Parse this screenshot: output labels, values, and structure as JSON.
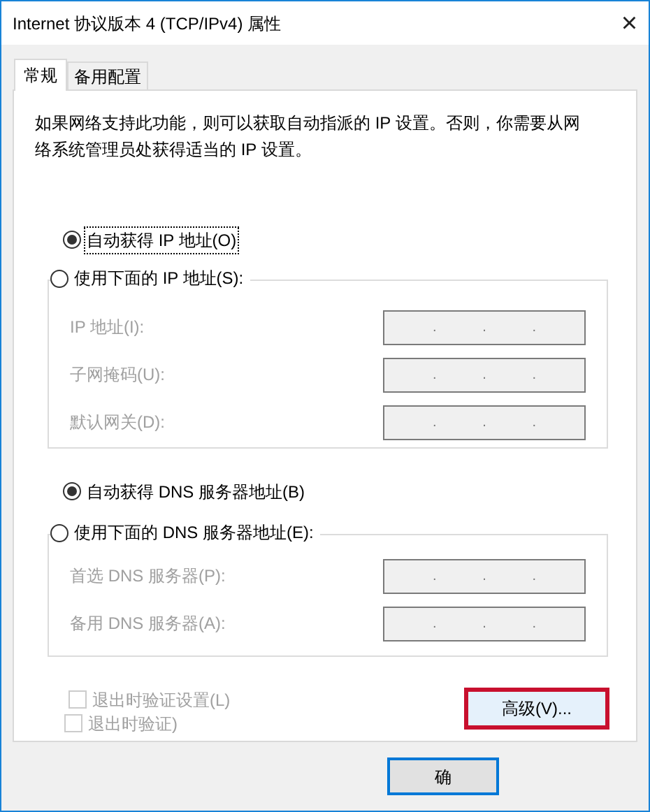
{
  "window": {
    "title": "Internet 协议版本 4 (TCP/IPv4) 属性",
    "close": "×"
  },
  "tabs": [
    {
      "label": "常规",
      "selected": true
    },
    {
      "label": "备用配置",
      "selected": false
    }
  ],
  "description": "如果网络支持此功能，则可以获取自动指派的 IP 设置。否则，你需要从网络系统管理员处获得适当的 IP 设置。",
  "ip_auto": {
    "label": "自动获得 IP 地址(O)",
    "selected": true,
    "focused": true
  },
  "ip_manual": {
    "label": "使用下面的 IP 地址(S):",
    "selected": false
  },
  "ip_fields": [
    {
      "label": "IP 地址(I):",
      "disabled": true,
      "separators": [
        ".",
        ".",
        "."
      ]
    },
    {
      "label": "子网掩码(U):",
      "disabled": true,
      "separators": [
        ".",
        ".",
        "."
      ]
    },
    {
      "label": "默认网关(D):",
      "disabled": true,
      "separators": [
        ".",
        ".",
        "."
      ]
    }
  ],
  "dns_auto": {
    "label": "自动获得 DNS 服务器地址(B)",
    "selected": true,
    "focused": false
  },
  "dns_manual": {
    "label": "使用下面的 DNS 服务器地址(E):",
    "selected": false
  },
  "dns_fields": [
    {
      "label": "首选 DNS 服务器(P):",
      "disabled": true,
      "separators": [
        ".",
        ".",
        "."
      ]
    },
    {
      "label": "备用 DNS 服务器(A):",
      "disabled": true,
      "separators": [
        ".",
        ".",
        "."
      ]
    }
  ],
  "checkboxes": [
    {
      "label": "退出时验证设置(L)",
      "checked": false,
      "disabled": true
    },
    {
      "label": "退出时验证)",
      "checked": false,
      "disabled": true
    }
  ],
  "advanced_button": {
    "label": "高级(V)...",
    "highlighted": true
  },
  "ok_button": {
    "label": "确",
    "default": true
  }
}
